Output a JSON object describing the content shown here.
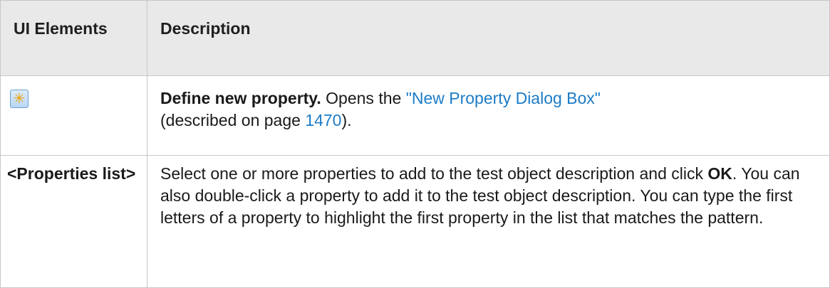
{
  "table": {
    "headers": {
      "ui_elements": "UI Elements",
      "description": "Description"
    },
    "rows": [
      {
        "icon": "new-property-star-icon",
        "icon_glyph": "✳",
        "desc_bold": "Define new property.",
        "desc_text1": " Opens the ",
        "desc_link": "\"New Property Dialog Box\"",
        "desc_text2": " (described on page ",
        "desc_page_link": "1470",
        "desc_text3": ")."
      },
      {
        "ui_label": "<Properties list>",
        "desc_text1": "Select one or more properties to add to the test object description and click ",
        "desc_bold": "OK",
        "desc_text2": ". You can also double-click a property to add it to the test object description. You can type the first letters of a property to highlight the first property in the list that matches the pattern."
      }
    ]
  },
  "colors": {
    "header_bg": "#e9e9e9",
    "border": "#c7c7c7",
    "link": "#1c7cc7"
  }
}
